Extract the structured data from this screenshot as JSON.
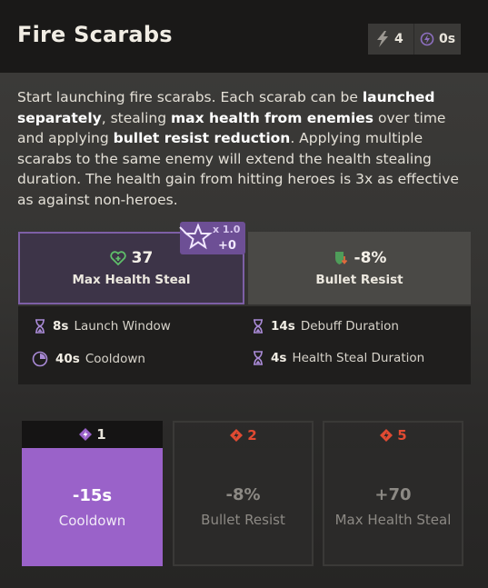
{
  "ability": {
    "title": "Fire Scarabs",
    "charges": "4",
    "cast_time": "0s"
  },
  "description": {
    "p1": "Start launching fire scarabs. Each scarab can be ",
    "b1": "launched separately",
    "p2": ", stealing ",
    "b2": "max health from enemies",
    "p3": " over time and applying ",
    "b3": "bullet resist reduction",
    "p4": ". Applying multiple scarabs to the same enemy will extend the health stealing duration. The health gain from hitting heroes is 3x as effective as against non-heroes."
  },
  "scaling": {
    "multiplier": "x 1.0",
    "bonus": "+0"
  },
  "main_props": [
    {
      "value": "37",
      "label": "Max Health Steal",
      "icon": "heart-plus-icon"
    },
    {
      "value": "-8%",
      "label": "Bullet Resist",
      "icon": "shield-down-icon"
    }
  ],
  "sub_props": [
    {
      "value": "8s",
      "label": "Launch Window",
      "icon": "hourglass-icon"
    },
    {
      "value": "14s",
      "label": "Debuff Duration",
      "icon": "hourglass-icon"
    },
    {
      "value": "40s",
      "label": "Cooldown",
      "icon": "cooldown-icon"
    },
    {
      "value": "4s",
      "label": "Health Steal Duration",
      "icon": "hourglass-icon"
    }
  ],
  "upgrades": [
    {
      "cost": "1",
      "value": "-15s",
      "label": "Cooldown",
      "unlocked": true
    },
    {
      "cost": "2",
      "value": "-8%",
      "label": "Bullet Resist",
      "unlocked": false
    },
    {
      "cost": "5",
      "value": "+70",
      "label": "Max Health Steal",
      "unlocked": false
    }
  ],
  "colors": {
    "accent_purple": "#9a62c9",
    "locked_red": "#e14a32",
    "health_green": "#5fbf6a"
  }
}
